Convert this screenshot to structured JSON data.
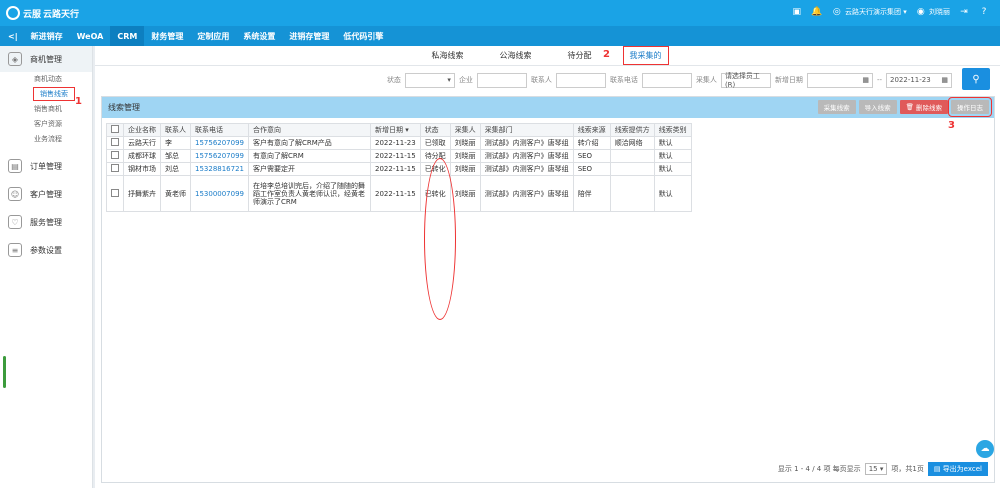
{
  "app": {
    "brand_name": "云路天行",
    "brand_prefix": "云服"
  },
  "topbar": {
    "company_selector": "云路天行演示集团",
    "user_name": "刘晓丽"
  },
  "nav": {
    "back": "<|",
    "items": [
      "新进销存",
      "WeOA",
      "CRM",
      "财务管理",
      "定制应用",
      "系统设置",
      "进销存管理",
      "低代码引擎"
    ],
    "active_index": 2
  },
  "sidebar": {
    "groups": [
      {
        "label": "商机管理",
        "icon": "cube-icon",
        "subitems": [
          "商机动态",
          "销售线索",
          "销售商机",
          "客户资源",
          "业务流程"
        ]
      },
      {
        "label": "订单管理",
        "icon": "order-icon"
      },
      {
        "label": "客户管理",
        "icon": "customer-icon"
      },
      {
        "label": "服务管理",
        "icon": "heart-icon"
      },
      {
        "label": "参数设置",
        "icon": "doc-icon"
      }
    ],
    "selected_sub": "销售线索"
  },
  "annotations": {
    "one": "1",
    "two": "2",
    "three": "3"
  },
  "tabs": [
    "私海线索",
    "公海线索",
    "待分配",
    "我采集的"
  ],
  "filters": {
    "status_label": "状态",
    "company_label": "企业",
    "contact_label": "联系人",
    "phone_label": "联系电话",
    "collector_label": "采集人",
    "collector_placeholder": "请选择员工 (R)",
    "date_label": "新增日期",
    "date_to": "2022-11-23",
    "range_sep": "--"
  },
  "panel": {
    "title": "线索管理",
    "buttons": {
      "collect": "采集线索",
      "import": "导入线索",
      "delete": "删除线索",
      "log": "操作日志"
    }
  },
  "table": {
    "headers": [
      "企业名称",
      "联系人",
      "联系电话",
      "合作意向",
      "新增日期 ▾",
      "状态",
      "采集人",
      "采集部门",
      "线索来源",
      "线索提供方",
      "线索类别"
    ],
    "rows": [
      [
        "云路天行",
        "李",
        "15756207099",
        "客户有意向了解CRM产品",
        "2022-11-23",
        "已领取",
        "刘晓丽",
        "测试部》内测客户》唐琴组",
        "转介绍",
        "顺洽网络",
        "默认"
      ],
      [
        "成都环球",
        "邹总",
        "15756207099",
        "有意向了解CRM",
        "2022-11-15",
        "待分配",
        "刘晓丽",
        "测试部》内测客户》唐琴组",
        "SEO",
        "",
        "默认"
      ],
      [
        "钢材市场",
        "刘总",
        "15328816721",
        "客户需要定开",
        "2022-11-15",
        "已转化",
        "刘晓丽",
        "测试部》内测客户》唐琴组",
        "SEO",
        "",
        "默认"
      ],
      [
        "抒舞紫卉",
        "黄老师",
        "15300007099",
        "在培李总培训完后，介绍了随随的舞蹈工作室负责人黄老师认识，经黄老师演示了CRM",
        "2022-11-15",
        "已转化",
        "刘晓丽",
        "测试部》内测客户》唐琴组",
        "陪伴",
        "",
        "默认"
      ]
    ]
  },
  "footer": {
    "summary": "显示 1 - 4 / 4 项  每页显示",
    "page_size": "15",
    "suffix": "项，共1页",
    "export": "导出为excel"
  }
}
